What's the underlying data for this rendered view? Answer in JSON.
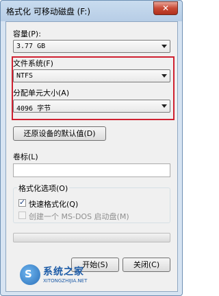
{
  "window": {
    "title": "格式化 可移动磁盘 (F:)",
    "close_glyph": "✕"
  },
  "capacity": {
    "label": "容量(P):",
    "value": "3.77 GB"
  },
  "filesystem": {
    "label": "文件系统(F)",
    "value": "NTFS"
  },
  "allocation": {
    "label": "分配单元大小(A)",
    "value": "4096 字节"
  },
  "restore_defaults_button": "还原设备的默认值(D)",
  "volume_label": {
    "label": "卷标(L)",
    "value": ""
  },
  "format_options": {
    "title": "格式化选项(O)",
    "quick_format": {
      "label": "快速格式化(Q)",
      "checked": true
    },
    "msdos_startup": {
      "label": "创建一个 MS-DOS 启动盘(M)",
      "checked": false,
      "disabled": true
    }
  },
  "progress": {
    "value": 0
  },
  "buttons": {
    "start": "开始(S)",
    "close": "关闭(C)"
  },
  "watermark": {
    "logo_glyph": "S",
    "text": "系统之家",
    "sub": "XITONGZHIJIA.NET"
  },
  "colors": {
    "highlight_box": "#cf2030",
    "title_bar": "#b7cde6",
    "progress_fill": "#3bb14a"
  }
}
